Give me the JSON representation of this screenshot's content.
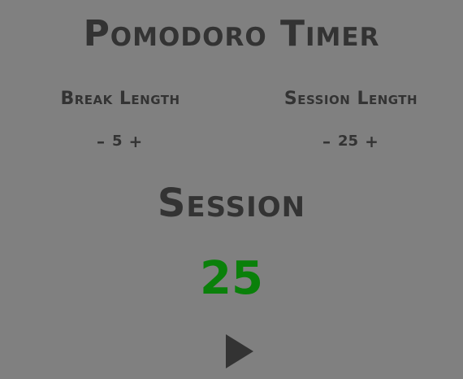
{
  "app": {
    "title": "Pomodoro Timer"
  },
  "break": {
    "label": "Break Length",
    "decrement_label": "–",
    "value": "5",
    "increment_label": "+"
  },
  "session": {
    "label": "Session Length",
    "decrement_label": "–",
    "value": "25",
    "increment_label": "+"
  },
  "timer": {
    "mode": "Session",
    "display": "25",
    "play_icon": "play-icon"
  },
  "colors": {
    "background": "#808080",
    "text": "#333333",
    "timer": "#0a800a"
  }
}
